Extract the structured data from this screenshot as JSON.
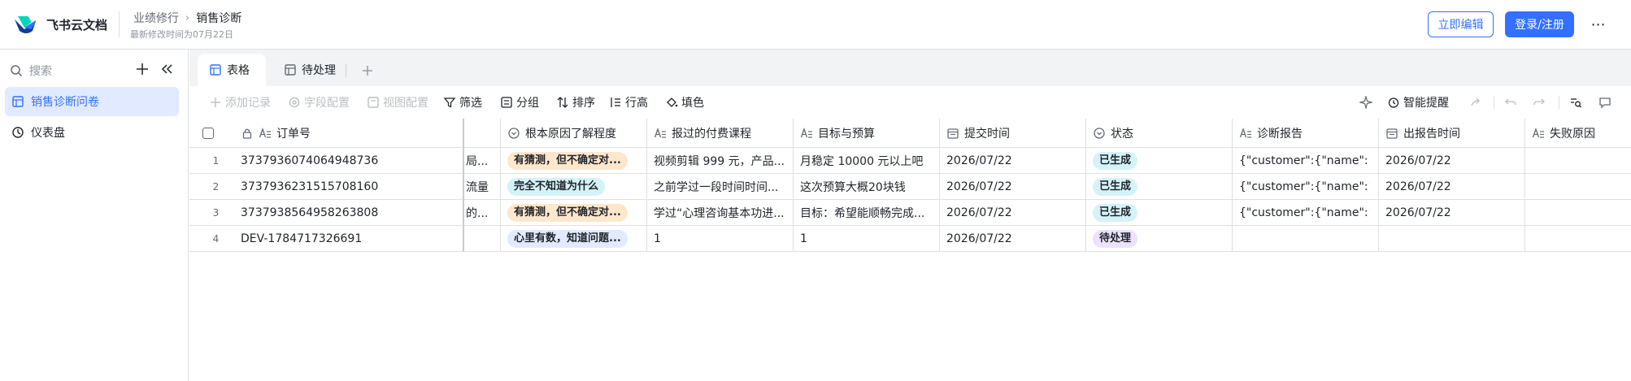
{
  "header": {
    "brand": "飞书云文档",
    "breadcrumb_parent": "业绩修行",
    "breadcrumb_current": "销售诊断",
    "subtitle": "最新修改时间为07月22日",
    "edit_button": "立即编辑",
    "login_button": "登录/注册",
    "more_label": "⋯"
  },
  "sidebar": {
    "search_placeholder": "搜索",
    "items": [
      {
        "label": "销售诊断问卷",
        "icon": "table-icon",
        "active": true
      },
      {
        "label": "仪表盘",
        "icon": "dashboard-icon",
        "active": false
      }
    ]
  },
  "tabs": [
    {
      "label": "表格",
      "icon": "grid-icon",
      "active": true
    },
    {
      "label": "待处理",
      "icon": "grid-icon",
      "active": false
    }
  ],
  "toolbar": {
    "add_record": "添加记录",
    "field_config": "字段配置",
    "view_config": "视图配置",
    "filter": "筛选",
    "group": "分组",
    "sort": "排序",
    "row_height": "行高",
    "fill_color": "填色",
    "smart_reminder": "智能提醒"
  },
  "table": {
    "headers": [
      "订单号",
      "根本原因了解程度",
      "报过的付费课程",
      "目标与预算",
      "提交时间",
      "状态",
      "诊断报告",
      "出报告时间",
      "失败原因"
    ],
    "rows": [
      {
        "num": "1",
        "order": "3737936074064948736",
        "hidden": "局...",
        "cause": "有猜测，但不确定对...",
        "cause_color": "orange",
        "course": "视频剪辑 999 元，产品...",
        "goal": "月稳定 10000 元以上吧",
        "submit": "2026/07/22",
        "status": "已生成",
        "status_color": "cyan",
        "report": "{\"customer\":{\"name\":\"...",
        "report_time": "2026/07/22",
        "fail": ""
      },
      {
        "num": "2",
        "order": "3737936231515708160",
        "hidden": "流量",
        "cause": "完全不知道为什么",
        "cause_color": "cyan",
        "course": "之前学过一段时间时间...",
        "goal": "这次预算大概20块钱",
        "submit": "2026/07/22",
        "status": "已生成",
        "status_color": "cyan",
        "report": "{\"customer\":{\"name\":\"...",
        "report_time": "2026/07/22",
        "fail": ""
      },
      {
        "num": "3",
        "order": "3737938564958263808",
        "hidden": "的...",
        "cause": "有猜测，但不确定对...",
        "cause_color": "orange",
        "course": "学过“心理咨询基本功进...",
        "goal": "目标：希望能顺畅完成...",
        "submit": "2026/07/22",
        "status": "已生成",
        "status_color": "cyan",
        "report": "{\"customer\":{\"name\":\"...",
        "report_time": "2026/07/22",
        "fail": ""
      },
      {
        "num": "4",
        "order": "DEV-1784717326691",
        "hidden": "",
        "cause": "心里有数，知道问题...",
        "cause_color": "blue",
        "course": "1",
        "goal": "1",
        "submit": "2026/07/22",
        "status": "待处理",
        "status_color": "purple",
        "report": "",
        "report_time": "",
        "fail": ""
      }
    ]
  },
  "colors": {
    "accent": "#3370ff",
    "tag_orange_bg": "#fee7cd",
    "tag_cyan_bg": "#d4f3f8",
    "tag_blue_bg": "#e1eaff",
    "tag_purple_bg": "#ece2fe"
  }
}
